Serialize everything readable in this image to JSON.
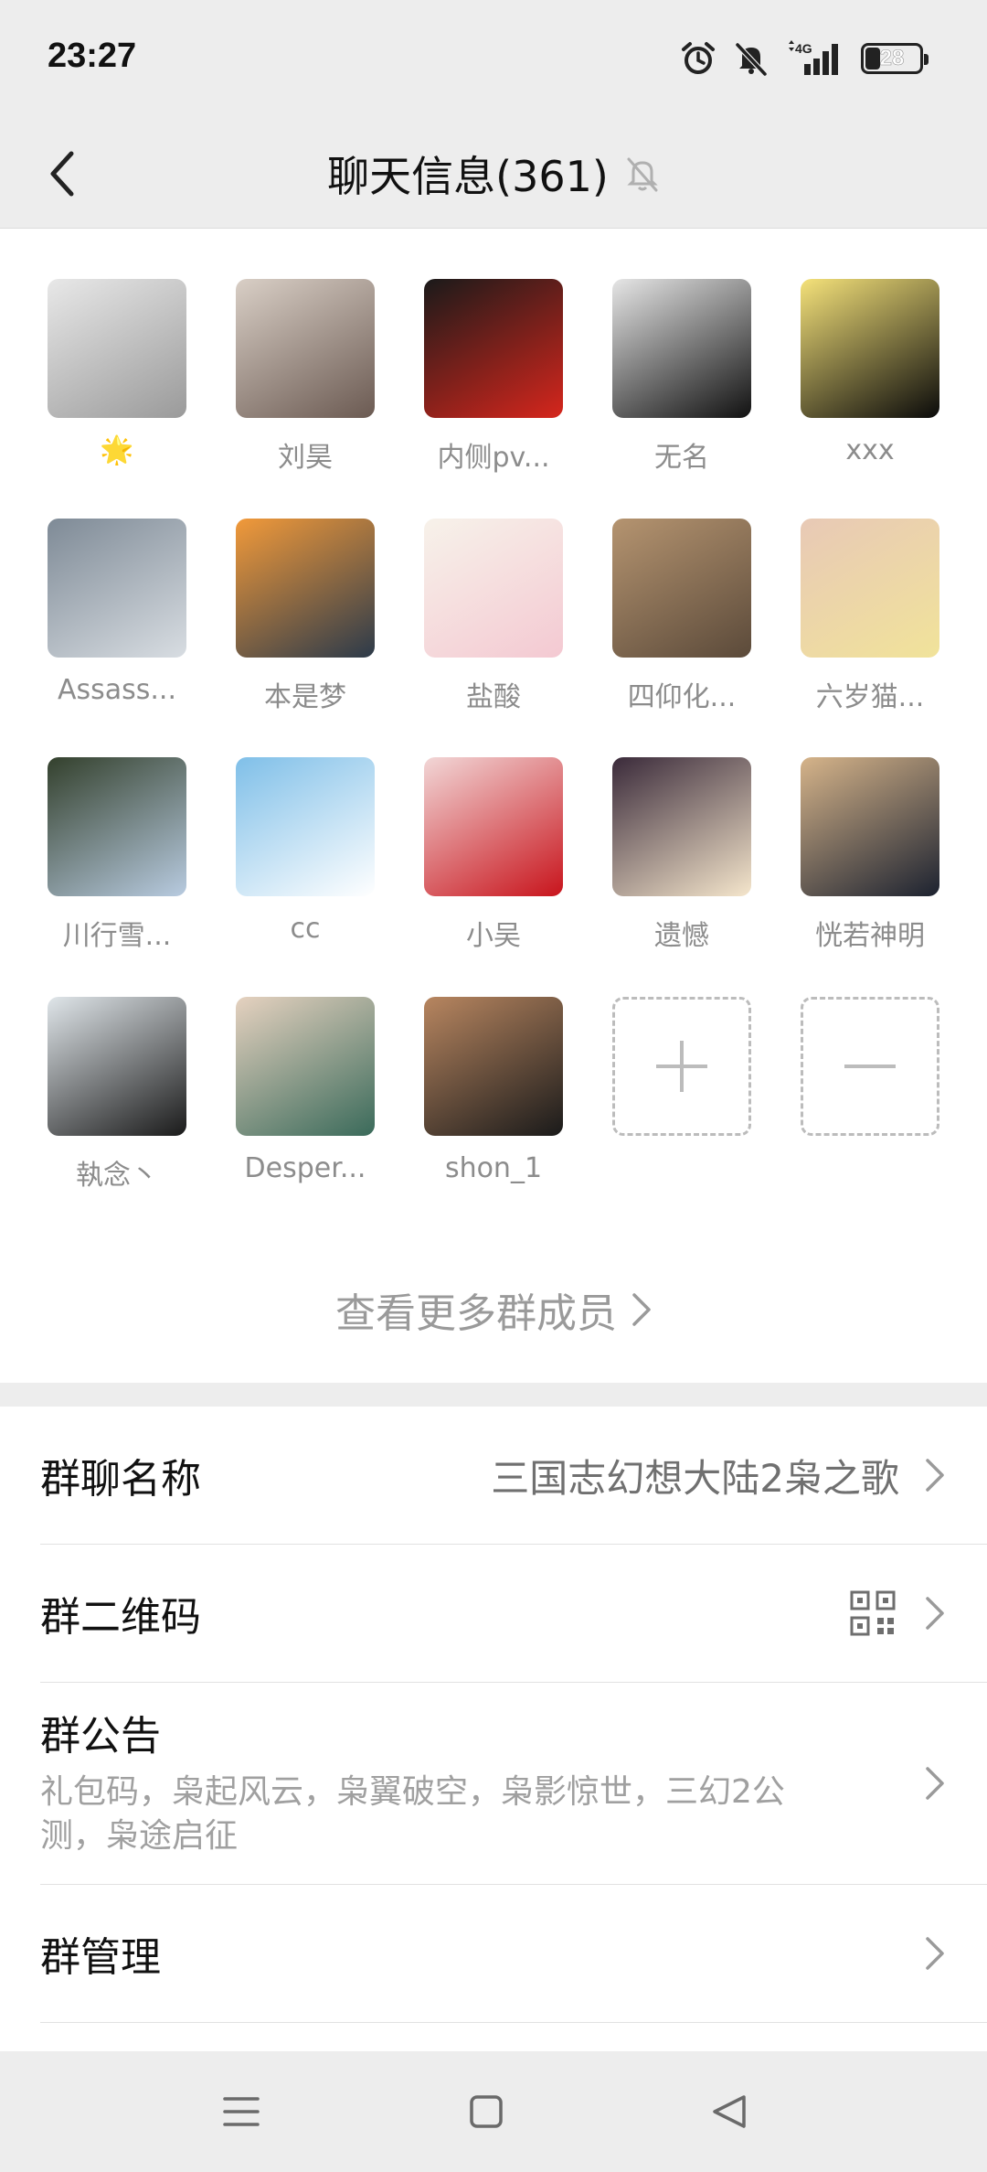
{
  "status_bar": {
    "time": "23:27",
    "network": "4G",
    "battery": "28",
    "icons": [
      "alarm-icon",
      "mute-icon",
      "signal-icon",
      "battery-icon"
    ]
  },
  "nav": {
    "title": "聊天信息(361)",
    "icons": [
      "back-icon",
      "mute-bell-icon"
    ]
  },
  "members": [
    {
      "name": "🌟",
      "avatar_colors": [
        "#9a9a9a",
        "#e8e8e8"
      ]
    },
    {
      "name": "刘昊",
      "avatar_colors": [
        "#6b5a52",
        "#d9cfc6"
      ]
    },
    {
      "name": "内侧pv...",
      "avatar_colors": [
        "#d6261c",
        "#1a1a1a"
      ]
    },
    {
      "name": "无名",
      "avatar_colors": [
        "#111111",
        "#e6e6e6"
      ]
    },
    {
      "name": "xxx",
      "avatar_colors": [
        "#0a0a0a",
        "#f5e27a"
      ]
    },
    {
      "name": "Assass...",
      "avatar_colors": [
        "#d8dde2",
        "#7e8a96"
      ]
    },
    {
      "name": "本是梦",
      "avatar_colors": [
        "#2c3a4a",
        "#f29a3a"
      ]
    },
    {
      "name": "盐酸",
      "avatar_colors": [
        "#f4c9d2",
        "#f7f2ea"
      ]
    },
    {
      "name": "四仰化...",
      "avatar_colors": [
        "#5b4a3a",
        "#b59470"
      ]
    },
    {
      "name": "六岁猫...",
      "avatar_colors": [
        "#f1e39a",
        "#e8c9b6"
      ]
    },
    {
      "name": "川行雪...",
      "avatar_colors": [
        "#b8cbe0",
        "#33402c"
      ]
    },
    {
      "name": "cc",
      "avatar_colors": [
        "#ffffff",
        "#7fbfe8"
      ]
    },
    {
      "name": "小吴",
      "avatar_colors": [
        "#c8141c",
        "#f2d7d7"
      ]
    },
    {
      "name": "遗憾",
      "avatar_colors": [
        "#f5e6cc",
        "#3a2a3a"
      ]
    },
    {
      "name": "恍若神明",
      "avatar_colors": [
        "#1c2230",
        "#d6b48a"
      ]
    },
    {
      "name": "執念丶",
      "avatar_colors": [
        "#1a1a1a",
        "#e0e6ea"
      ]
    },
    {
      "name": "Desper...",
      "avatar_colors": [
        "#3a6a5a",
        "#e6d2c0"
      ]
    },
    {
      "name": "shon_1",
      "avatar_colors": [
        "#1a1a1a",
        "#b88660"
      ]
    }
  ],
  "member_actions": {
    "add": "add-member",
    "remove": "remove-member"
  },
  "more_members_label": "查看更多群成员",
  "settings": {
    "group_name_label": "群聊名称",
    "group_name_value": "三国志幻想大陆2枭之歌",
    "qr_label": "群二维码",
    "notice_label": "群公告",
    "notice_text_line1": "礼包码，枭起风云，枭翼破空，枭影惊世，三幻2公",
    "notice_text_line2": "测，枭途启征",
    "manage_label": "群管理"
  }
}
